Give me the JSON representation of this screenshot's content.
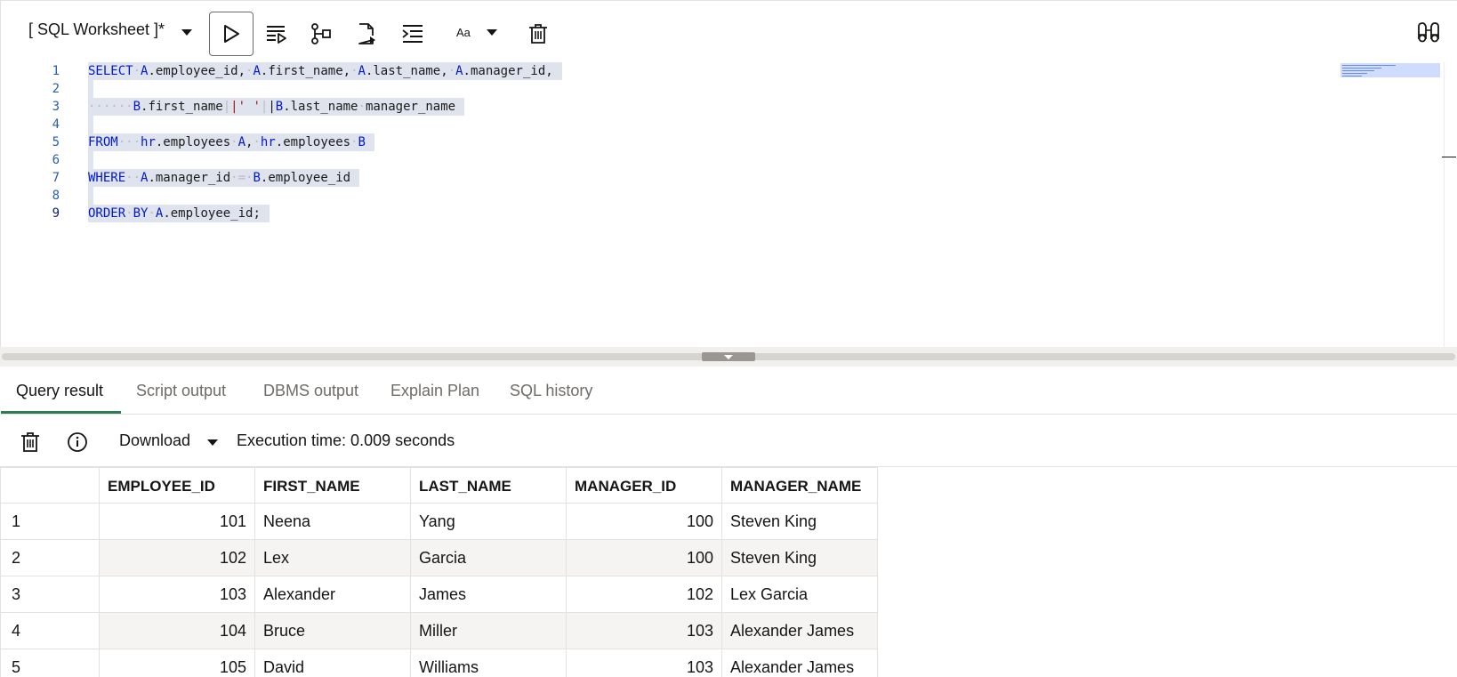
{
  "toolbar": {
    "worksheet_title": "[ SQL Worksheet ]*",
    "font_label": "Aa",
    "icons": [
      "run-statement-icon",
      "run-script-icon",
      "explain-plan-icon",
      "autotrace-icon",
      "format-icon",
      "font-size-icon",
      "clear-icon",
      "find-icon"
    ]
  },
  "editor": {
    "lines": [
      {
        "number": "1",
        "text": "SELECT A.employee_id, A.first_name, A.last_name, A.manager_id,"
      },
      {
        "number": "2",
        "text": ""
      },
      {
        "number": "3",
        "text": "      B.first_name||' '||B.last_name manager_name"
      },
      {
        "number": "4",
        "text": ""
      },
      {
        "number": "5",
        "text": "FROM   hr.employees A, hr.employees B"
      },
      {
        "number": "6",
        "text": ""
      },
      {
        "number": "7",
        "text": "WHERE  A.manager_id = B.employee_id"
      },
      {
        "number": "8",
        "text": ""
      },
      {
        "number": "9",
        "text": "ORDER BY A.employee_id;"
      }
    ]
  },
  "result_tabs": {
    "items": [
      "Query result",
      "Script output",
      "DBMS output",
      "Explain Plan",
      "SQL history"
    ],
    "active": "Query result"
  },
  "result_toolbar": {
    "download_label": "Download",
    "execution_time": "Execution time: 0.009 seconds"
  },
  "grid": {
    "columns": [
      "EMPLOYEE_ID",
      "FIRST_NAME",
      "LAST_NAME",
      "MANAGER_ID",
      "MANAGER_NAME"
    ],
    "rows": [
      {
        "row": "1",
        "cells": [
          "101",
          "Neena",
          "Yang",
          "100",
          "Steven King"
        ]
      },
      {
        "row": "2",
        "cells": [
          "102",
          "Lex",
          "Garcia",
          "100",
          "Steven King"
        ]
      },
      {
        "row": "3",
        "cells": [
          "103",
          "Alexander",
          "James",
          "102",
          "Lex Garcia"
        ]
      },
      {
        "row": "4",
        "cells": [
          "104",
          "Bruce",
          "Miller",
          "103",
          "Alexander James"
        ]
      },
      {
        "row": "5",
        "cells": [
          "105",
          "David",
          "Williams",
          "103",
          "Alexander James"
        ]
      }
    ]
  },
  "colors": {
    "keyword": "#0019c9",
    "string": "#a31515",
    "selection": "#dfe3ee",
    "active_tab_underline": "#2d7b54"
  }
}
